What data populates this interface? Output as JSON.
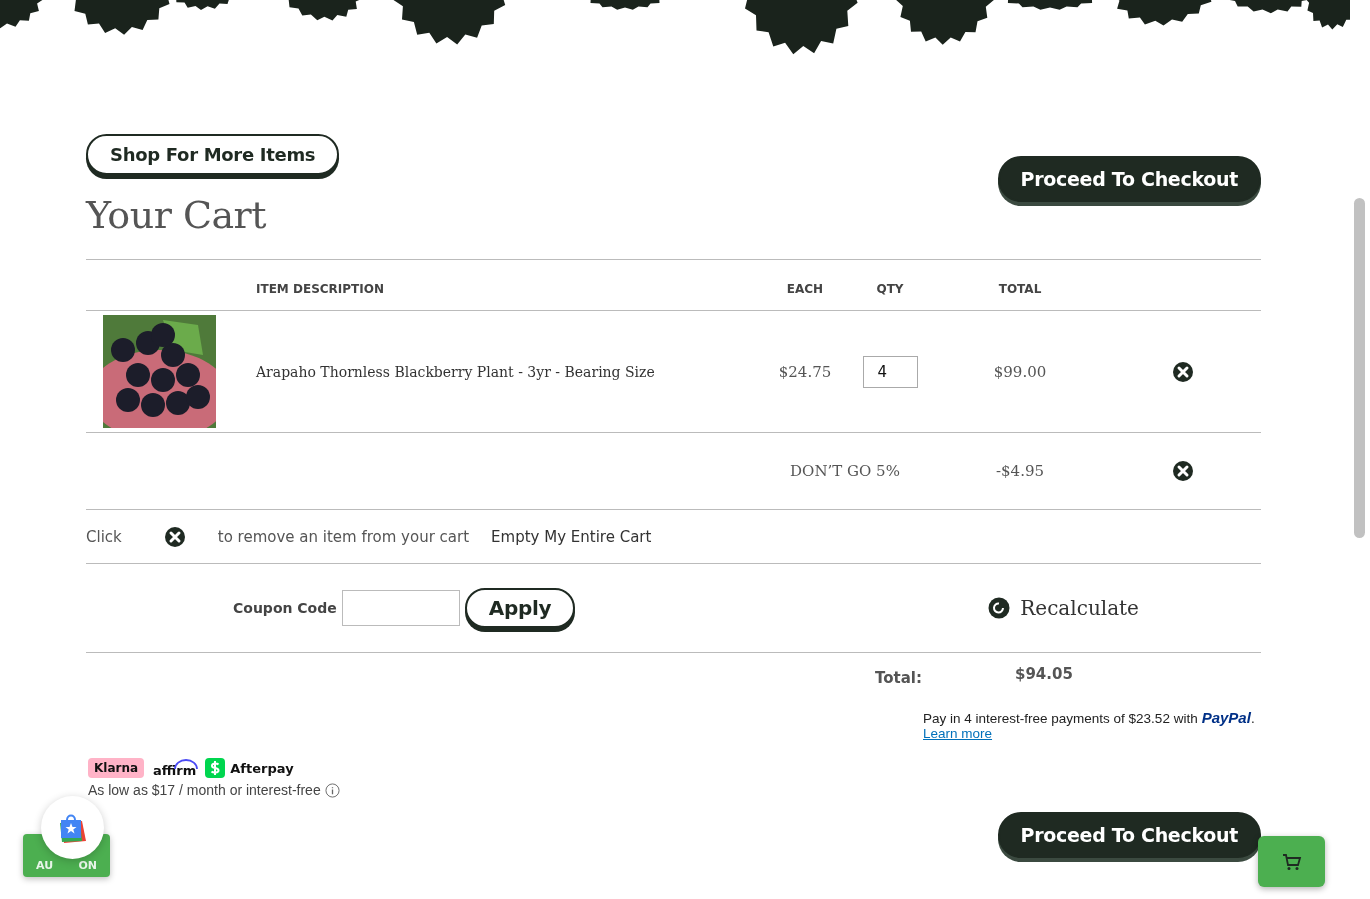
{
  "shop_button": "Shop For More Items",
  "checkout_button": "Proceed To Checkout",
  "title": "Your Cart",
  "columns": [
    "ITEM DESCRIPTION",
    "EACH",
    "QTY",
    "TOTAL"
  ],
  "items": [
    {
      "description": "Arapaho Thornless Blackberry Plant - 3yr - Bearing Size",
      "each": "$24.75",
      "qty": "4",
      "total": "$99.00"
    }
  ],
  "discount": {
    "label": "DON’T GO 5%",
    "amount": "-$4.95"
  },
  "hint": {
    "before": "Click",
    "after": "to remove an item from your cart",
    "empty_link": "Empty My Entire Cart"
  },
  "coupon": {
    "label": "Coupon Code",
    "button": "Apply"
  },
  "recalculate": "Recalculate",
  "total": {
    "label": "Total:",
    "value": "$94.05"
  },
  "paypal": {
    "message": "Pay in 4 interest-free payments of $23.52 with",
    "brand": "PayPal",
    "period": ".",
    "link": "Learn more"
  },
  "financing": {
    "klarna": "Klarna",
    "affirm": "affirm",
    "afterpay": "Afterpay",
    "note": "As low as $17 / month or interest-free"
  },
  "bottom_checkout_button": "Proceed To Checkout",
  "autocoupon": {
    "left": "AU",
    "right": "ON"
  }
}
